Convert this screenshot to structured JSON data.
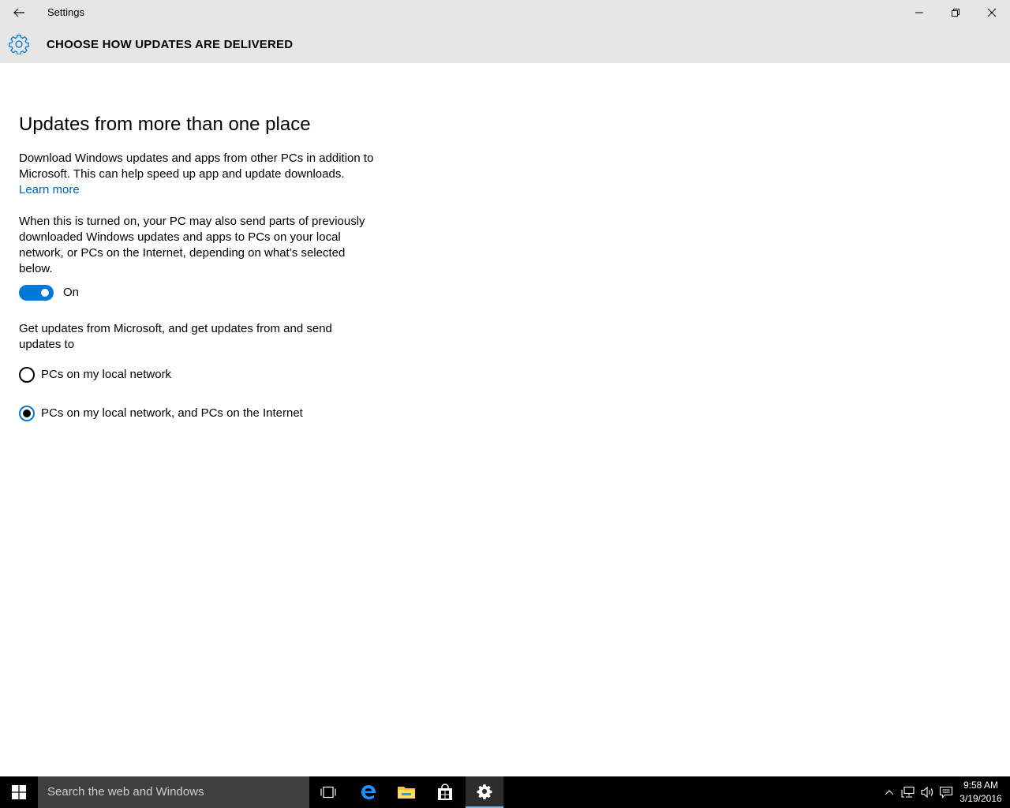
{
  "window": {
    "title": "Settings"
  },
  "header": {
    "title": "CHOOSE HOW UPDATES ARE DELIVERED"
  },
  "content": {
    "heading": "Updates from more than one place",
    "description": "Download Windows updates and apps from other PCs in addition to Microsoft. This can help speed up app and update downloads.",
    "learn_more": "Learn more",
    "explanation": "When this is turned on, your PC may also send parts of previously downloaded Windows updates and apps to PCs on your local network, or PCs on the Internet, depending on what’s selected below.",
    "toggle": {
      "state": "On",
      "on": true
    },
    "source_prompt": "Get updates from Microsoft, and get updates from and send updates to",
    "options": [
      {
        "label": "PCs on my local network",
        "selected": false
      },
      {
        "label": "PCs on my local network, and PCs on the Internet",
        "selected": true
      }
    ]
  },
  "taskbar": {
    "search_placeholder": "Search the web and Windows",
    "time": "9:58 AM",
    "date": "3/19/2016"
  },
  "colors": {
    "accent": "#0078d7",
    "link": "#0063b1",
    "chrome": "#e6e6e6",
    "taskbar": "#000000"
  }
}
